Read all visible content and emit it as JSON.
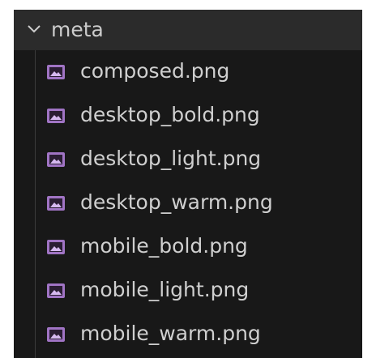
{
  "explorer": {
    "folder": {
      "name": "meta",
      "expanded": true,
      "icon": "chevron-down-icon"
    },
    "files": [
      {
        "name": "composed.png",
        "icon": "image-file-icon"
      },
      {
        "name": "desktop_bold.png",
        "icon": "image-file-icon"
      },
      {
        "name": "desktop_light.png",
        "icon": "image-file-icon"
      },
      {
        "name": "desktop_warm.png",
        "icon": "image-file-icon"
      },
      {
        "name": "mobile_bold.png",
        "icon": "image-file-icon"
      },
      {
        "name": "mobile_light.png",
        "icon": "image-file-icon"
      },
      {
        "name": "mobile_warm.png",
        "icon": "image-file-icon"
      }
    ],
    "colors": {
      "panel_background": "#181818",
      "header_background": "#2b2b2b",
      "text": "#cfcfcf",
      "image_icon": "#a074c4"
    }
  }
}
